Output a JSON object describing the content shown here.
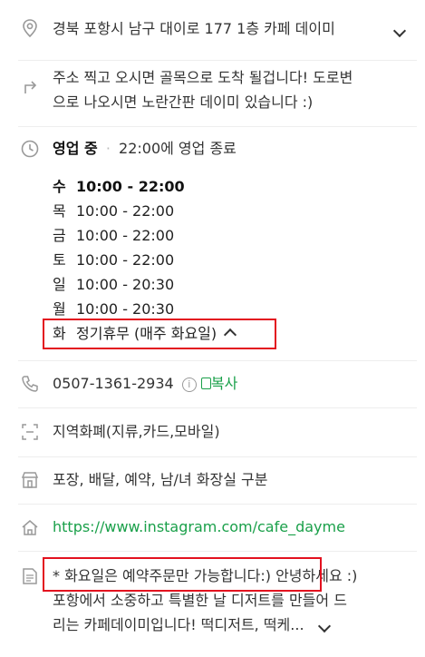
{
  "address": {
    "text": "경북 포항시 남구 대이로 177 1층 카페 데이미"
  },
  "directions": {
    "line1": "주소 찍고 오시면 골목으로 도착 될겁니다! 도로변",
    "line2": "으로 나오시면 노란간판 데이미 있습니다 :)"
  },
  "hours": {
    "status": "영업 중",
    "closing": "22:00에 영업 종료",
    "days": [
      {
        "day": "수",
        "time": "10:00 - 22:00"
      },
      {
        "day": "목",
        "time": "10:00 - 22:00"
      },
      {
        "day": "금",
        "time": "10:00 - 22:00"
      },
      {
        "day": "토",
        "time": "10:00 - 22:00"
      },
      {
        "day": "일",
        "time": "10:00 - 20:30"
      },
      {
        "day": "월",
        "time": "10:00 - 20:30"
      },
      {
        "day": "화",
        "time": "정기휴무 (매주 화요일)"
      }
    ]
  },
  "phone": {
    "number": "0507-1361-2934",
    "info": "i",
    "copy_label": "복사"
  },
  "payment": {
    "text": "지역화폐(지류,카드,모바일)"
  },
  "amenities": {
    "text": "포장, 배달, 예약, 남/녀 화장실 구분"
  },
  "website": {
    "url": "https://www.instagram.com/cafe_dayme"
  },
  "description": {
    "notice": "* 화요일은 예약주문만 가능합니다:)",
    "line1_rest": " 안녕하세요 :)",
    "line2": "포항에서 소중하고 특별한 날 디저트를 만들어 드",
    "line3": "리는 카페데이미입니다! 떡디저트, 떡케..."
  },
  "colors": {
    "highlight": "#e3111f",
    "link": "#1aa04a",
    "text": "#333333"
  }
}
